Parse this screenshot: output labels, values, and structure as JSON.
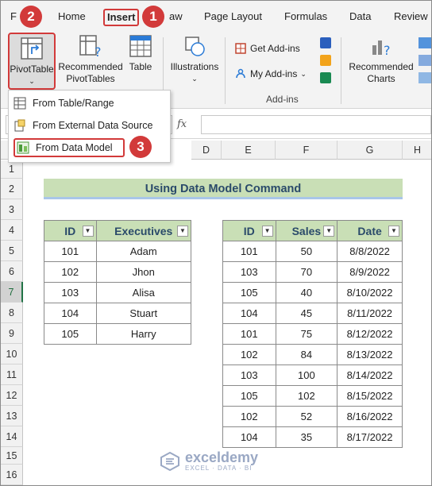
{
  "tabs": [
    "F",
    "Home",
    "Insert",
    "aw",
    "Page Layout",
    "Formulas",
    "Data",
    "Review"
  ],
  "ribbon": {
    "pivottable_label": "PivotTable",
    "recommended_pivot_label": "Recommended PivotTables",
    "table_label": "Table",
    "illustrations_label": "Illustrations",
    "get_addins_label": "Get Add-ins",
    "my_addins_label": "My Add-ins",
    "addins_group_label": "Add-ins",
    "recommended_charts_label": "Recommended Charts"
  },
  "dropdown": {
    "items": [
      "From Table/Range",
      "From External Data Source",
      "From Data Model"
    ]
  },
  "badges": [
    "1",
    "2",
    "3"
  ],
  "formula_bar": {
    "fx": "fx"
  },
  "columns": [
    "D",
    "E",
    "F",
    "G",
    "H"
  ],
  "rows": [
    "1",
    "2",
    "3",
    "4",
    "5",
    "6",
    "7",
    "8",
    "9",
    "10",
    "11",
    "12",
    "13",
    "14",
    "15",
    "16"
  ],
  "sheet_title": "Using Data Model Command",
  "table1": {
    "headers": [
      "ID",
      "Executives"
    ],
    "rows": [
      [
        "101",
        "Adam"
      ],
      [
        "102",
        "Jhon"
      ],
      [
        "103",
        "Alisa"
      ],
      [
        "104",
        "Stuart"
      ],
      [
        "105",
        "Harry"
      ]
    ]
  },
  "table2": {
    "headers": [
      "ID",
      "Sales",
      "Date"
    ],
    "rows": [
      [
        "101",
        "50",
        "8/8/2022"
      ],
      [
        "103",
        "70",
        "8/9/2022"
      ],
      [
        "105",
        "40",
        "8/10/2022"
      ],
      [
        "104",
        "45",
        "8/11/2022"
      ],
      [
        "101",
        "75",
        "8/12/2022"
      ],
      [
        "102",
        "84",
        "8/13/2022"
      ],
      [
        "103",
        "100",
        "8/14/2022"
      ],
      [
        "105",
        "102",
        "8/15/2022"
      ],
      [
        "102",
        "52",
        "8/16/2022"
      ],
      [
        "104",
        "35",
        "8/17/2022"
      ]
    ]
  },
  "watermark": {
    "name": "exceldemy",
    "tagline": "EXCEL · DATA · BI"
  },
  "colors": {
    "accent": "#d23a3a",
    "header_fill": "#c9dfb6",
    "excel_green": "#217346"
  }
}
